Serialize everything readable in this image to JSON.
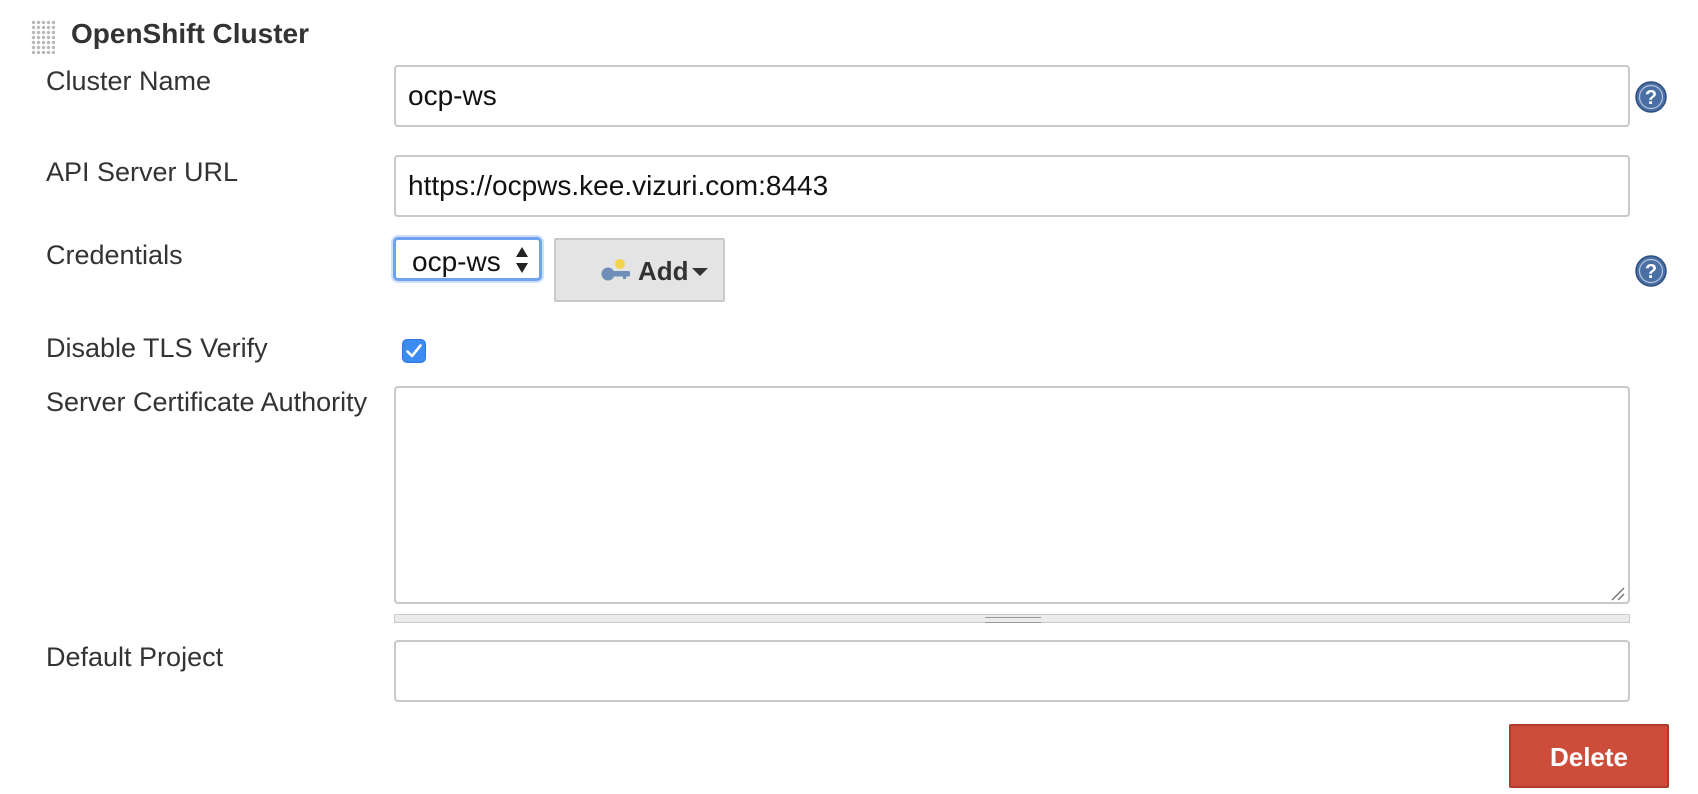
{
  "section": {
    "title": "OpenShift Cluster"
  },
  "fields": {
    "cluster_name": {
      "label": "Cluster Name",
      "value": "ocp-ws"
    },
    "api_server_url": {
      "label": "API Server URL",
      "value": "https://ocpws.kee.vizuri.com:8443"
    },
    "credentials": {
      "label": "Credentials",
      "selected": "ocp-ws",
      "add_label": "Add"
    },
    "disable_tls_verify": {
      "label": "Disable TLS Verify",
      "checked": true
    },
    "server_certificate_authority": {
      "label": "Server Certificate Authority",
      "value": ""
    },
    "default_project": {
      "label": "Default Project",
      "value": ""
    }
  },
  "actions": {
    "delete_label": "Delete"
  },
  "icons": {
    "drag_handle": "drag-handle-icon",
    "help": "help-icon",
    "key": "key-icon",
    "caret": "caret-down-icon",
    "check": "checkmark-icon"
  },
  "colors": {
    "help_icon": "#4a6fa5",
    "checkbox": "#3b8bf2",
    "select_focus": "#6fa3f2",
    "delete_button": "#cd4d3b",
    "add_button": "#e4e4e4"
  }
}
